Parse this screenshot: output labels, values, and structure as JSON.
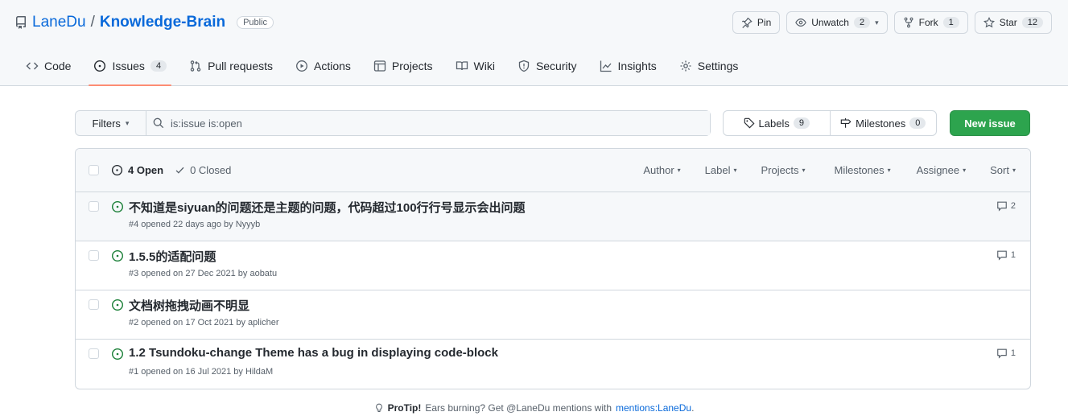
{
  "repo": {
    "owner": "LaneDu",
    "separator": "/",
    "name": "Knowledge-Brain",
    "visibility": "Public"
  },
  "actions": {
    "pin_label": "Pin",
    "unwatch_label": "Unwatch",
    "unwatch_count": "2",
    "fork_label": "Fork",
    "fork_count": "1",
    "star_label": "Star",
    "star_count": "12"
  },
  "tabs": [
    {
      "label": "Code",
      "icon": "code-icon"
    },
    {
      "label": "Issues",
      "icon": "issue-opened-icon",
      "count": "4",
      "active": true
    },
    {
      "label": "Pull requests",
      "icon": "git-pull-request-icon"
    },
    {
      "label": "Actions",
      "icon": "play-icon"
    },
    {
      "label": "Projects",
      "icon": "table-icon"
    },
    {
      "label": "Wiki",
      "icon": "book-icon"
    },
    {
      "label": "Security",
      "icon": "shield-icon"
    },
    {
      "label": "Insights",
      "icon": "graph-icon"
    },
    {
      "label": "Settings",
      "icon": "gear-icon"
    }
  ],
  "toolbar": {
    "filters_label": "Filters",
    "search_value": "is:issue is:open",
    "labels_label": "Labels",
    "labels_count": "9",
    "milestones_label": "Milestones",
    "milestones_count": "0",
    "new_issue_label": "New issue"
  },
  "list_header": {
    "open_label": "4 Open",
    "closed_label": "0 Closed",
    "filters": [
      "Author",
      "Label",
      "Projects",
      "Milestones",
      "Assignee",
      "Sort"
    ]
  },
  "issues": [
    {
      "title": "不知道是siyuan的问题还是主题的问题，代码超过100行行号显示会出问题",
      "meta": "#4 opened 22 days ago by Nyyyb",
      "comments": "2"
    },
    {
      "title": "1.5.5的适配问题",
      "meta": "#3 opened on 27 Dec 2021 by aobatu",
      "comments": "1"
    },
    {
      "title": "文档树拖拽动画不明显",
      "meta": "#2 opened on 17 Oct 2021 by aplicher",
      "comments": ""
    },
    {
      "title": "1.2 Tsundoku-change Theme has a bug in displaying code-block",
      "meta": "#1 opened on 16 Jul 2021 by HildaM",
      "comments": "1"
    }
  ],
  "protip": {
    "bold": "ProTip!",
    "text": "Ears burning? Get @LaneDu mentions with",
    "link": "mentions:LaneDu",
    "end": "."
  },
  "colors": {
    "accent_blue": "#0969da",
    "open_green": "#1a7f37",
    "new_issue_green": "#2da44e",
    "tab_underline": "#fd8c73"
  }
}
